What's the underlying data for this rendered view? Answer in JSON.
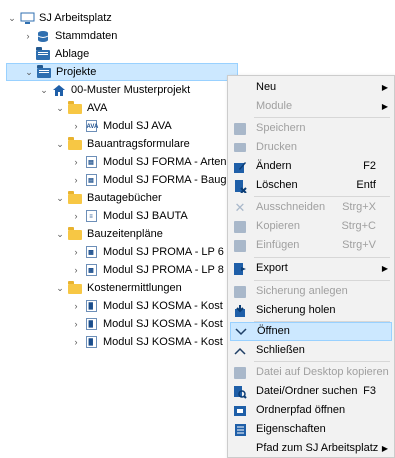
{
  "tree": {
    "root": "SJ Arbeitsplatz",
    "items": [
      {
        "label": "Stammdaten"
      },
      {
        "label": "Ablage"
      },
      {
        "label": "Projekte"
      },
      {
        "label": "00-Muster Musterprojekt"
      },
      {
        "label": "AVA"
      },
      {
        "label": "Modul SJ AVA"
      },
      {
        "label": "Bauantragsformulare"
      },
      {
        "label": "Modul SJ FORMA - Arten"
      },
      {
        "label": "Modul SJ FORMA - Baug"
      },
      {
        "label": "Bautagebücher"
      },
      {
        "label": "Modul SJ BAUTA"
      },
      {
        "label": "Bauzeitenpläne"
      },
      {
        "label": "Modul SJ PROMA - LP 6"
      },
      {
        "label": "Modul SJ PROMA - LP 8"
      },
      {
        "label": "Kostenermittlungen"
      },
      {
        "label": "Modul SJ KOSMA - Kost"
      },
      {
        "label": "Modul SJ KOSMA - Kost"
      },
      {
        "label": "Modul SJ KOSMA - Kost"
      }
    ]
  },
  "menu": {
    "items": [
      {
        "label": "Neu",
        "shortcut": "",
        "submenu": true,
        "disabled": false
      },
      {
        "label": "Module",
        "shortcut": "",
        "submenu": true,
        "disabled": true
      },
      {
        "label": "Speichern",
        "shortcut": "",
        "disabled": true
      },
      {
        "label": "Drucken",
        "shortcut": "",
        "disabled": true
      },
      {
        "label": "Ändern",
        "shortcut": "F2",
        "disabled": false
      },
      {
        "label": "Löschen",
        "shortcut": "Entf",
        "disabled": false
      },
      {
        "label": "Ausschneiden",
        "shortcut": "Strg+X",
        "disabled": true
      },
      {
        "label": "Kopieren",
        "shortcut": "Strg+C",
        "disabled": true
      },
      {
        "label": "Einfügen",
        "shortcut": "Strg+V",
        "disabled": true
      },
      {
        "label": "Export",
        "shortcut": "",
        "submenu": true,
        "disabled": false
      },
      {
        "label": "Sicherung anlegen",
        "shortcut": "",
        "disabled": true
      },
      {
        "label": "Sicherung holen",
        "shortcut": "",
        "disabled": false
      },
      {
        "label": "Öffnen",
        "shortcut": "",
        "disabled": false,
        "highlighted": true
      },
      {
        "label": "Schließen",
        "shortcut": "",
        "disabled": false
      },
      {
        "label": "Datei auf Desktop kopieren",
        "shortcut": "",
        "disabled": true
      },
      {
        "label": "Datei/Ordner suchen",
        "shortcut": "F3",
        "disabled": false
      },
      {
        "label": "Ordnerpfad öffnen",
        "shortcut": "",
        "disabled": false
      },
      {
        "label": "Eigenschaften",
        "shortcut": "",
        "disabled": false
      },
      {
        "label": "Pfad zum SJ Arbeitsplatz",
        "shortcut": "",
        "submenu": true,
        "disabled": false
      }
    ]
  },
  "colors": {
    "selection": "#cce8ff",
    "selection_border": "#99d1ff",
    "folder": "#f7c744",
    "icon_blue": "#1f5fa8"
  }
}
